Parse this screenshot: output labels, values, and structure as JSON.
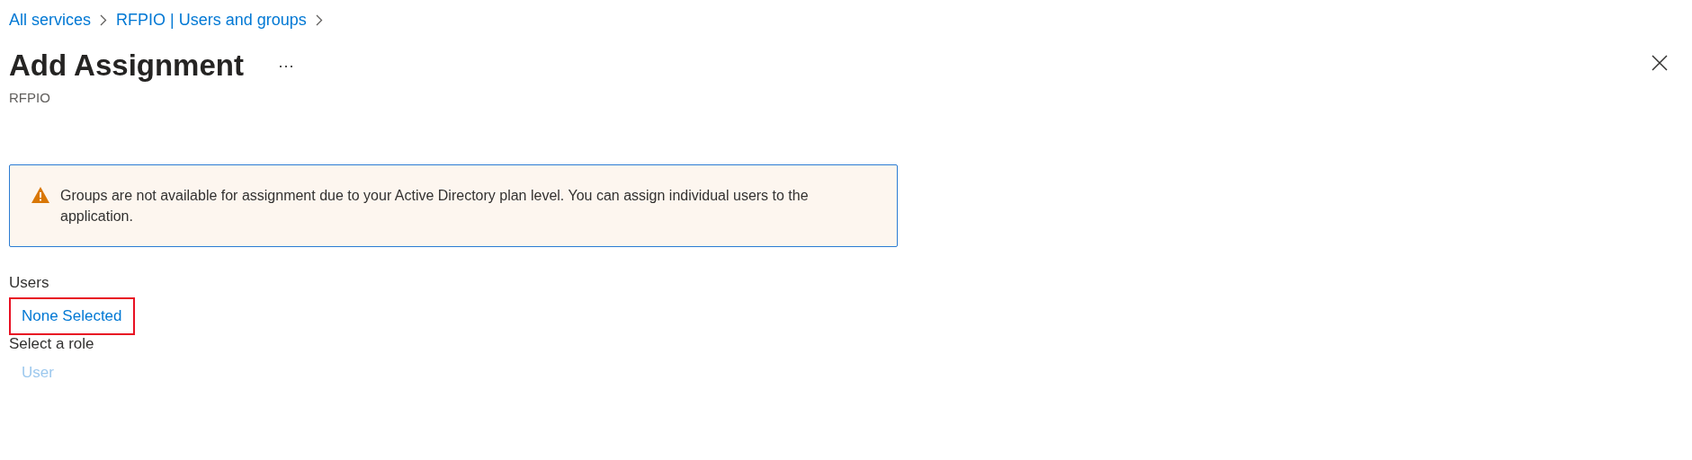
{
  "breadcrumb": [
    {
      "label": "All services"
    },
    {
      "label": "RFPIO | Users and groups"
    }
  ],
  "header": {
    "title": "Add Assignment",
    "more": "···",
    "subtitle": "RFPIO"
  },
  "banner": {
    "kind": "warning",
    "text": "Groups are not available for assignment due to your Active Directory plan level. You can assign individual users to the application."
  },
  "users": {
    "label": "Users",
    "link": "None Selected",
    "highlighted": true
  },
  "role": {
    "label": "Select a role",
    "link": "User",
    "disabled": true
  }
}
